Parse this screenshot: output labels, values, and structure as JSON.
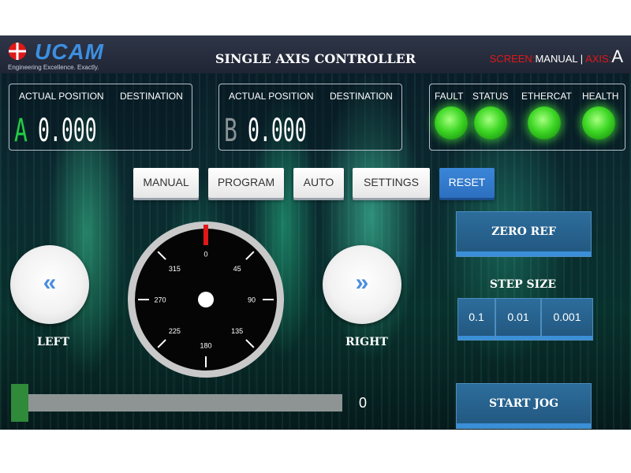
{
  "header": {
    "logo_text": "UCAM",
    "logo_tagline": "Engineering Excellence. Exactly.",
    "title": "SINGLE AXIS CONTROLLER",
    "screen_label": "SCREEN:",
    "screen_value": "MANUAL",
    "separator": "|",
    "axis_label": "AXIS:",
    "axis_value": "A"
  },
  "position_panels": [
    {
      "actual_label": "ACTUAL POSITION",
      "dest_label": "DESTINATION",
      "axis": "A",
      "value": "0.000",
      "axis_color": "#22cc44"
    },
    {
      "actual_label": "ACTUAL POSITION",
      "dest_label": "DESTINATION",
      "axis": "B",
      "value": "0.000",
      "axis_color": "#8a9296"
    }
  ],
  "indicators": {
    "labels": [
      "FAULT",
      "STATUS",
      "ETHERCAT",
      "HEALTH"
    ],
    "color": "#3fd826"
  },
  "tabs": [
    "MANUAL",
    "PROGRAM",
    "AUTO",
    "SETTINGS",
    "RESET"
  ],
  "dial": {
    "ticks": [
      "0",
      "45",
      "90",
      "135",
      "180",
      "225",
      "270",
      "315"
    ],
    "pointer_color": "#e01818"
  },
  "jog": {
    "left_label": "LEFT",
    "right_label": "RIGHT",
    "left_icon": "double-chevron-left-icon",
    "right_icon": "double-chevron-right-icon",
    "left_arrow": "«",
    "right_arrow": "»"
  },
  "controls": {
    "zero_ref": "ZERO REF",
    "step_size_label": "STEP SIZE",
    "step_sizes": [
      "0.1",
      "0.01",
      "0.001"
    ],
    "start_jog": "START JOG"
  },
  "speed_slider": {
    "value": "0",
    "fraction": 0
  },
  "colors": {
    "accent_blue": "#3a86d8",
    "brand_red": "#e01818"
  }
}
